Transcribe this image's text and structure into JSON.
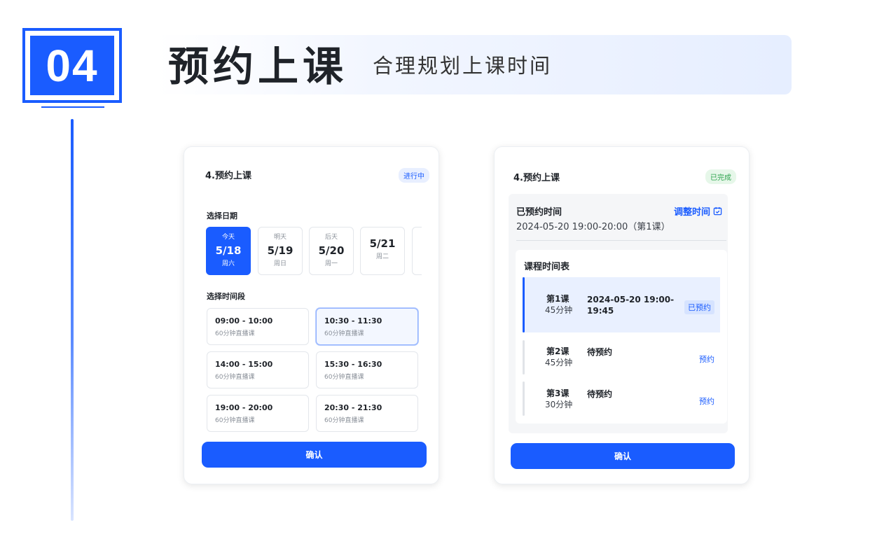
{
  "header": {
    "step_number": "04",
    "title": "预约上课",
    "subtitle": "合理规划上课时间"
  },
  "left_card": {
    "title": "4.预约上课",
    "status_tag": "进行中",
    "date_section_label": "选择日期",
    "dates": [
      {
        "top": "今天",
        "date": "5/18",
        "week": "周六",
        "selected": true
      },
      {
        "top": "明天",
        "date": "5/19",
        "week": "周日",
        "selected": false
      },
      {
        "top": "后天",
        "date": "5/20",
        "week": "周一",
        "selected": false
      },
      {
        "top": "",
        "date": "5/21",
        "week": "周二",
        "selected": false
      }
    ],
    "time_section_label": "选择时间段",
    "slots": [
      {
        "time": "09:00 - 10:00",
        "desc": "60分钟直播课",
        "selected": false
      },
      {
        "time": "10:30 - 11:30",
        "desc": "60分钟直播课",
        "selected": true
      },
      {
        "time": "14:00 - 15:00",
        "desc": "60分钟直播课",
        "selected": false
      },
      {
        "time": "15:30 - 16:30",
        "desc": "60分钟直播课",
        "selected": false
      },
      {
        "time": "19:00 - 20:00",
        "desc": "60分钟直播课",
        "selected": false
      },
      {
        "time": "20:30 - 21:30",
        "desc": "60分钟直播课",
        "selected": false
      }
    ],
    "confirm_label": "确认"
  },
  "right_card": {
    "title": "4.预约上课",
    "status_tag": "已完成",
    "booked_label": "已预约时间",
    "booked_value": "2024-05-20 19:00-20:00（第1课）",
    "adjust_label": "调整时间",
    "schedule_title": "课程时间表",
    "lessons": [
      {
        "num": "第1课",
        "duration": "45分钟",
        "info": "2024-05-20 19:00-19:45",
        "status": "已预约"
      },
      {
        "num": "第2课",
        "duration": "45分钟",
        "info": "待预约",
        "status": "预约"
      },
      {
        "num": "第3课",
        "duration": "30分钟",
        "info": "待预约",
        "status": "预约"
      }
    ],
    "confirm_label": "确认"
  },
  "colors": {
    "primary": "#1a5cff",
    "success": "#2ea44f",
    "muted_text": "#8a9099"
  }
}
